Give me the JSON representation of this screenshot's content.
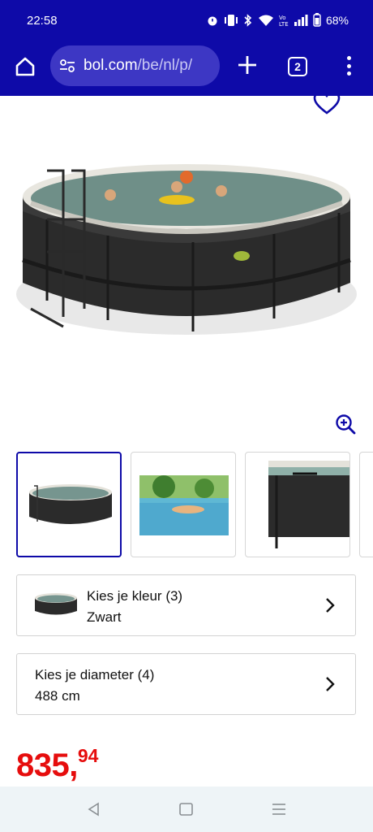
{
  "status_bar": {
    "time": "22:58",
    "battery": "68%",
    "icons": [
      "alarm-icon",
      "vibrate-icon",
      "bluetooth-icon",
      "wifi-icon",
      "volte-icon",
      "signal-icon",
      "battery-icon"
    ]
  },
  "browser": {
    "url_host": "bol.com",
    "url_path": "/be/nl/p/",
    "tab_count": "2",
    "icons": [
      "home-icon",
      "site-settings-icon",
      "plus-icon",
      "tabs-icon",
      "more-menu-icon"
    ]
  },
  "product": {
    "color_selector": {
      "title": "Kies je kleur (3)",
      "value": "Zwart"
    },
    "diameter_selector": {
      "title": "Kies je diameter (4)",
      "value": "488 cm"
    },
    "price": {
      "main": "835,",
      "cents": "94"
    },
    "icons": [
      "heart-icon",
      "zoom-in-icon",
      "chevron-right-icon"
    ]
  },
  "colors": {
    "header_bg": "#0e0aa8",
    "urlbar_bg": "#3d37c4",
    "price": "#e60d0d",
    "accent": "#0e0aa8"
  },
  "navigation_bar": {
    "icons": [
      "back-icon",
      "home-nav-icon",
      "recents-icon"
    ]
  }
}
